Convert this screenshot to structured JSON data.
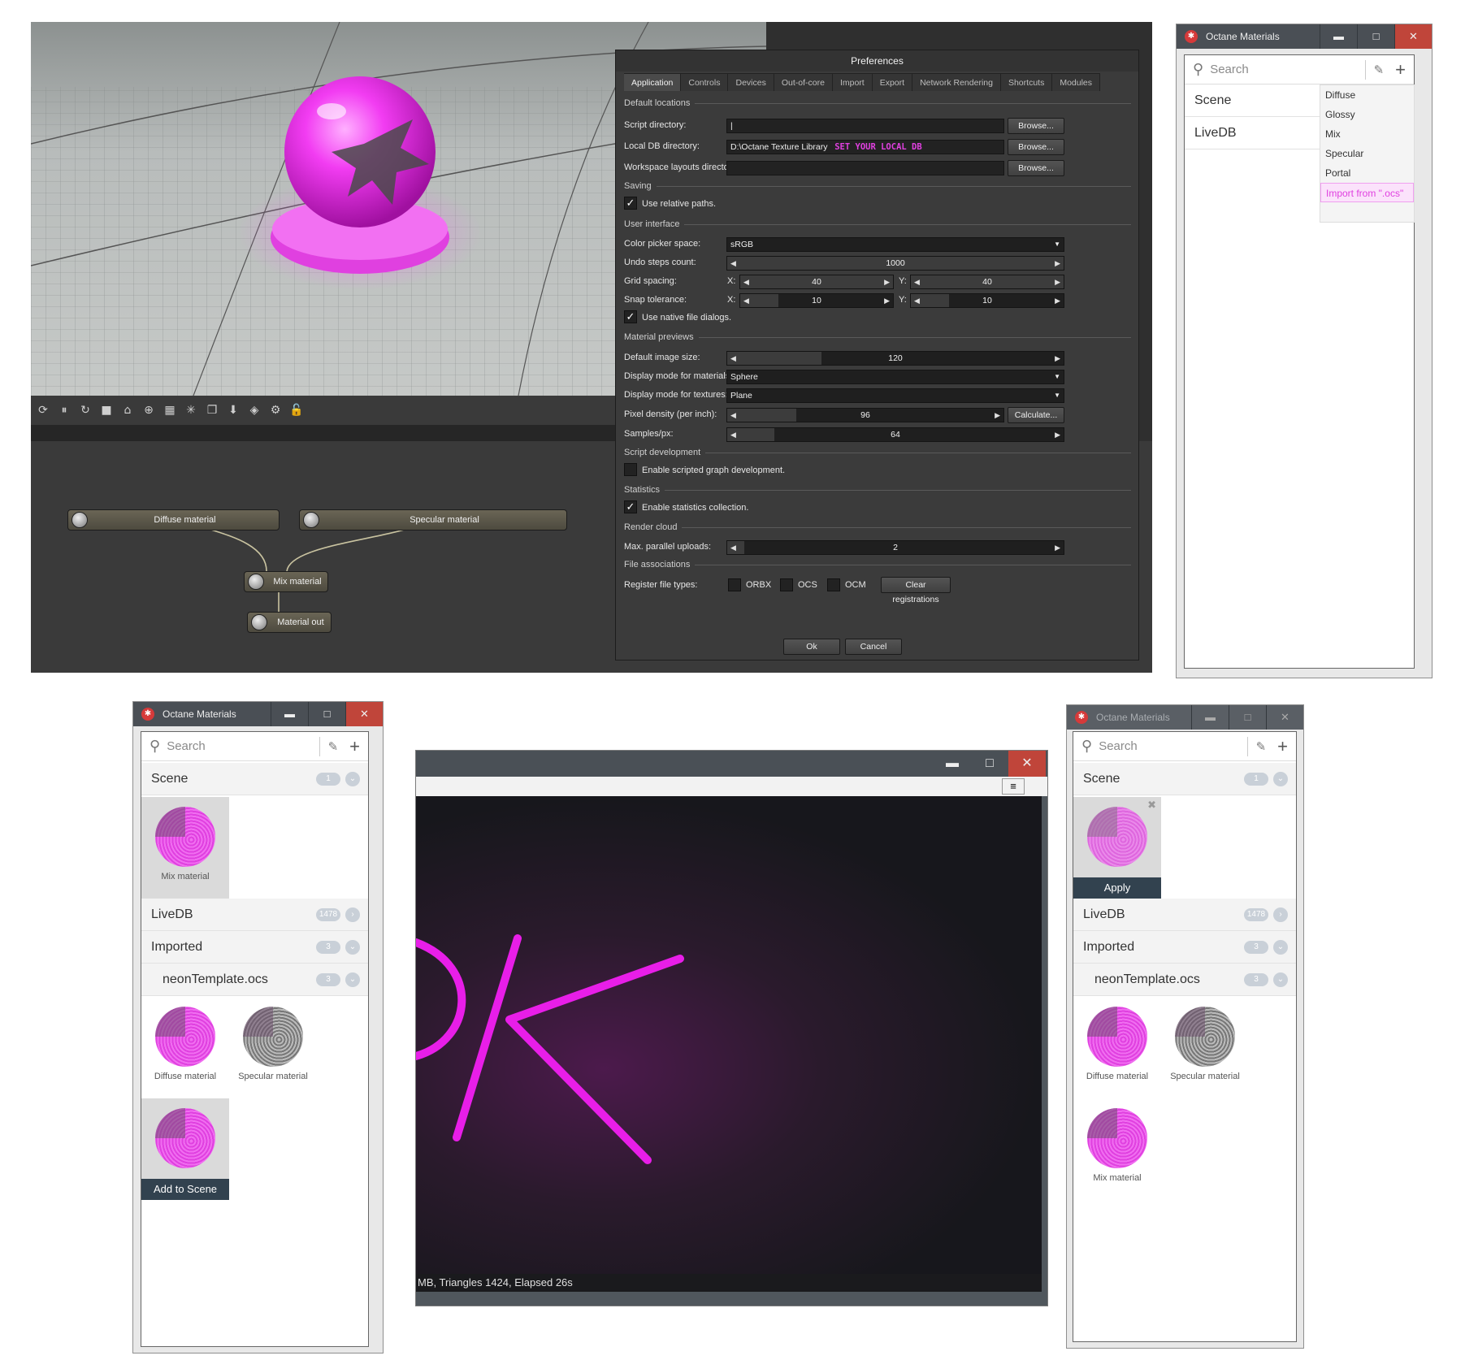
{
  "editor": {
    "prefs": {
      "title": "Preferences",
      "tabs": [
        "Application",
        "Controls",
        "Devices",
        "Out-of-core",
        "Import",
        "Export",
        "Network Rendering",
        "Shortcuts",
        "Modules"
      ],
      "sections": {
        "default_locations": "Default locations",
        "saving": "Saving",
        "user_interface": "User interface",
        "material_previews": "Material previews",
        "script_development": "Script development",
        "statistics": "Statistics",
        "render_cloud": "Render cloud",
        "file_associations": "File associations"
      },
      "labels": {
        "script_dir": "Script directory:",
        "local_db_dir": "Local DB directory:",
        "workspace_dir": "Workspace layouts directory:",
        "use_relative": "Use relative paths.",
        "color_picker": "Color picker space:",
        "undo_steps": "Undo steps count:",
        "grid_spacing": "Grid spacing:",
        "snap_tolerance": "Snap tolerance:",
        "native_dialogs": "Use native file dialogs.",
        "default_image_size": "Default image size:",
        "display_materials": "Display mode for materials:",
        "display_textures": "Display mode for textures:",
        "pixel_density": "Pixel density (per inch):",
        "samples": "Samples/px:",
        "enable_scripted": "Enable scripted graph development.",
        "enable_stats": "Enable statistics collection.",
        "max_uploads": "Max. parallel uploads:",
        "register_types": "Register file types:",
        "x": "X:",
        "y": "Y:"
      },
      "values": {
        "local_db_path": "D:\\Octane Texture Library",
        "local_db_note": "SET YOUR LOCAL DB",
        "color_picker": "sRGB",
        "undo_steps": "1000",
        "grid_x": "40",
        "grid_y": "40",
        "snap_x": "10",
        "snap_y": "10",
        "default_image_size": "120",
        "display_materials": "Sphere",
        "display_textures": "Plane",
        "pixel_density": "96",
        "samples": "64",
        "max_uploads": "2",
        "file_types": [
          "ORBX",
          "OCS",
          "OCM"
        ]
      },
      "buttons": {
        "browse": "Browse...",
        "calculate": "Calculate...",
        "clear": "Clear registrations",
        "ok": "Ok",
        "cancel": "Cancel"
      }
    },
    "graph": {
      "diffuse": "Diffuse material",
      "specular": "Specular material",
      "mix": "Mix material",
      "out": "Material out"
    }
  },
  "win_top": {
    "title": "Octane Materials",
    "search": "Search",
    "scene": "Scene",
    "livedb": "LiveDB",
    "menu": [
      "Diffuse",
      "Glossy",
      "Mix",
      "Specular",
      "Portal",
      "Import from \".ocs\""
    ]
  },
  "win_left": {
    "title": "Octane Materials",
    "search": "Search",
    "scene": "Scene",
    "scene_count": "1",
    "scene_tile": "Mix material",
    "livedb": "LiveDB",
    "livedb_count": "1478",
    "imported": "Imported",
    "imported_count": "3",
    "file": "neonTemplate.ocs",
    "file_count": "3",
    "tiles": [
      "Diffuse material",
      "Specular material"
    ],
    "add_to_scene": "Add to Scene"
  },
  "win_right": {
    "title": "Octane Materials",
    "search": "Search",
    "scene": "Scene",
    "scene_count": "1",
    "apply": "Apply",
    "livedb": "LiveDB",
    "livedb_count": "1478",
    "imported": "Imported",
    "imported_count": "3",
    "file": "neonTemplate.ocs",
    "file_count": "3",
    "tiles": [
      "Diffuse material",
      "Specular material",
      "Mix material"
    ]
  },
  "render": {
    "status": "MB, Triangles 1424, Elapsed 26s"
  }
}
